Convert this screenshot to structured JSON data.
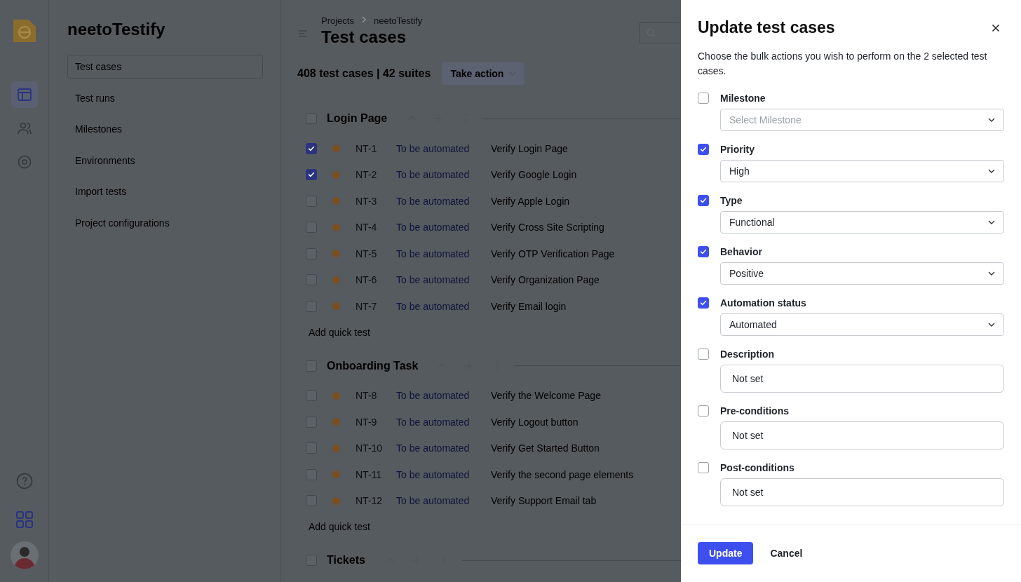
{
  "app": {
    "brand": "neetoTestify",
    "nav_items": [
      {
        "label": "Test cases",
        "selected": true
      },
      {
        "label": "Test runs",
        "selected": false
      },
      {
        "label": "Milestones",
        "selected": false
      },
      {
        "label": "Environments",
        "selected": false
      },
      {
        "label": "Import tests",
        "selected": false
      },
      {
        "label": "Project configurations",
        "selected": false
      }
    ]
  },
  "header": {
    "breadcrumbs": [
      "Projects",
      "neetoTestify"
    ],
    "title": "Test cases",
    "summary": "408 test cases | 42 suites",
    "action": "Take action"
  },
  "suites": [
    {
      "name": "Login Page",
      "checked": false,
      "add_label": "Add quick test",
      "tests": [
        {
          "id": "NT-1",
          "status": "To be automated",
          "title": "Verify Login Page",
          "checked": true
        },
        {
          "id": "NT-2",
          "status": "To be automated",
          "title": "Verify Google Login",
          "checked": true
        },
        {
          "id": "NT-3",
          "status": "To be automated",
          "title": "Verify Apple Login",
          "checked": false
        },
        {
          "id": "NT-4",
          "status": "To be automated",
          "title": "Verify Cross Site Scripting",
          "checked": false
        },
        {
          "id": "NT-5",
          "status": "To be automated",
          "title": "Verify OTP Verification Page",
          "checked": false
        },
        {
          "id": "NT-6",
          "status": "To be automated",
          "title": "Verify Organization Page",
          "checked": false
        },
        {
          "id": "NT-7",
          "status": "To be automated",
          "title": "Verify Email login",
          "checked": false
        }
      ]
    },
    {
      "name": "Onboarding Task",
      "checked": false,
      "add_label": "Add quick test",
      "tests": [
        {
          "id": "NT-8",
          "status": "To be automated",
          "title": "Verify the Welcome Page",
          "checked": false
        },
        {
          "id": "NT-9",
          "status": "To be automated",
          "title": "Verify Logout button",
          "checked": false
        },
        {
          "id": "NT-10",
          "status": "To be automated",
          "title": "Verify Get Started Button",
          "checked": false
        },
        {
          "id": "NT-11",
          "status": "To be automated",
          "title": "Verify the second page elements",
          "checked": false
        },
        {
          "id": "NT-12",
          "status": "To be automated",
          "title": "Verify Support Email tab",
          "checked": false
        }
      ]
    },
    {
      "name": "Tickets",
      "checked": false
    }
  ],
  "drawer": {
    "title": "Update test cases",
    "description": "Choose the bulk actions you wish to perform on the 2 selected test cases.",
    "fields": [
      {
        "label": "Milestone",
        "checked": false,
        "kind": "select",
        "placeholder": "Select Milestone"
      },
      {
        "label": "Priority",
        "checked": true,
        "kind": "select",
        "value": "High"
      },
      {
        "label": "Type",
        "checked": true,
        "kind": "select",
        "value": "Functional"
      },
      {
        "label": "Behavior",
        "checked": true,
        "kind": "select",
        "value": "Positive"
      },
      {
        "label": "Automation status",
        "checked": true,
        "kind": "select",
        "value": "Automated"
      },
      {
        "label": "Description",
        "checked": false,
        "kind": "text",
        "value": "Not set"
      },
      {
        "label": "Pre-conditions",
        "checked": false,
        "kind": "text",
        "value": "Not set"
      },
      {
        "label": "Post-conditions",
        "checked": false,
        "kind": "text",
        "value": "Not set"
      }
    ],
    "buttons": [
      {
        "label": "Update",
        "kind": "primary"
      },
      {
        "label": "Cancel",
        "kind": "plain"
      }
    ]
  }
}
